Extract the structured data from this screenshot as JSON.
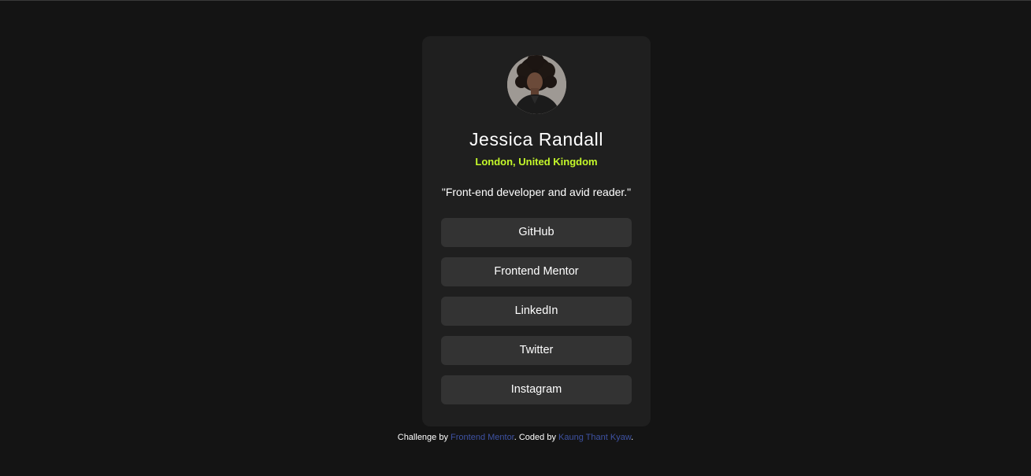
{
  "profile": {
    "avatar_alt": "Jessica Randall avatar",
    "name": "Jessica Randall",
    "location": "London, United Kingdom",
    "bio": "\"Front-end developer and avid reader.\"",
    "accent_color": "#c4f82a"
  },
  "links": [
    {
      "label": "GitHub"
    },
    {
      "label": "Frontend Mentor"
    },
    {
      "label": "LinkedIn"
    },
    {
      "label": "Twitter"
    },
    {
      "label": "Instagram"
    }
  ],
  "attribution": {
    "prefix": "Challenge by ",
    "challenge_link": "Frontend Mentor",
    "middle": ". Coded by ",
    "author_link": "Kaung Thant Kyaw",
    "suffix": ".",
    "link_color": "#3e52a3"
  }
}
